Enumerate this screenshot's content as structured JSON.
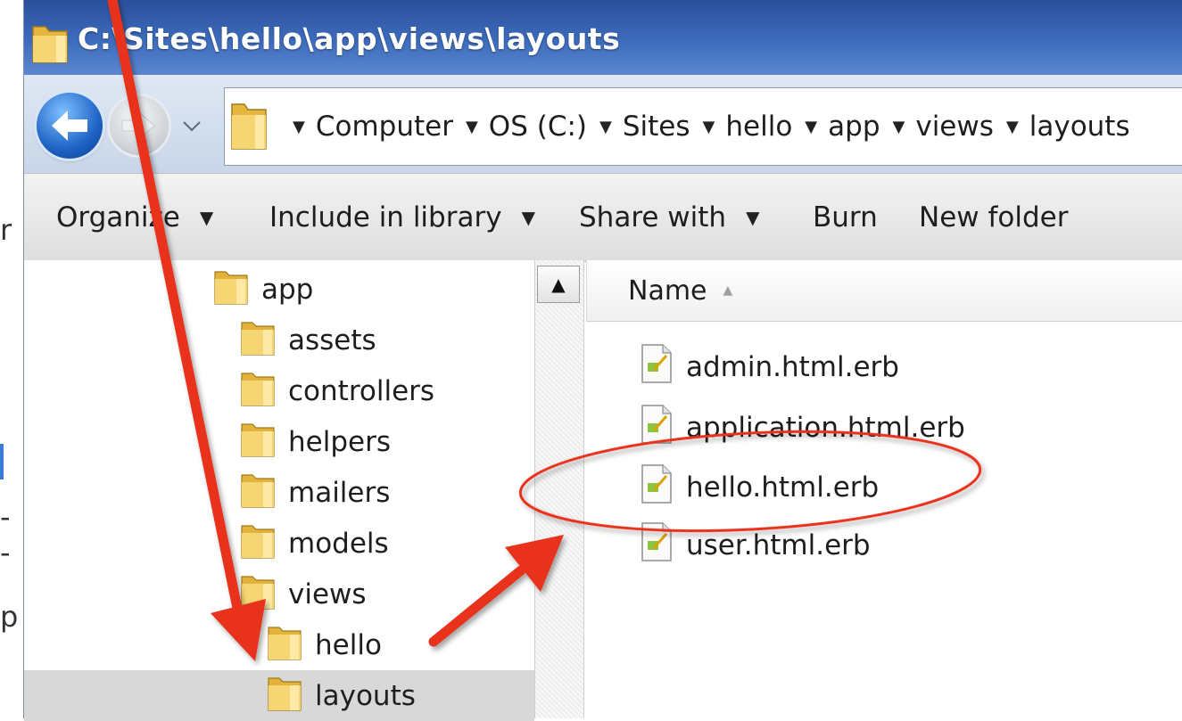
{
  "window": {
    "title": "C:\\Sites\\hello\\app\\views\\layouts"
  },
  "background_window": {
    "fragments": [
      "r",
      "-",
      "-",
      "p"
    ]
  },
  "address_bar": {
    "crumbs": [
      "Computer",
      "OS (C:)",
      "Sites",
      "hello",
      "app",
      "views",
      "layouts"
    ]
  },
  "commands": {
    "organize": "Organize",
    "include_in_library": "Include in library",
    "share_with": "Share with",
    "burn": "Burn",
    "new_folder": "New folder"
  },
  "nav_tree": {
    "items": [
      {
        "label": "app",
        "depth": 0
      },
      {
        "label": "assets",
        "depth": 1
      },
      {
        "label": "controllers",
        "depth": 1
      },
      {
        "label": "helpers",
        "depth": 1
      },
      {
        "label": "mailers",
        "depth": 1
      },
      {
        "label": "models",
        "depth": 1
      },
      {
        "label": "views",
        "depth": 1
      },
      {
        "label": "hello",
        "depth": 2
      },
      {
        "label": "layouts",
        "depth": 2,
        "selected": true
      }
    ]
  },
  "file_list": {
    "column_name": "Name",
    "files": [
      "admin.html.erb",
      "application.html.erb",
      "hello.html.erb",
      "user.html.erb"
    ],
    "highlighted_file": "hello.html.erb"
  },
  "icons": {
    "back": "back-arrow-icon",
    "forward": "forward-arrow-icon",
    "folder": "folder-icon",
    "file": "erb-file-icon"
  },
  "colors": {
    "annotation": "#e8321e",
    "titlebar": "#2f5aa8",
    "selection": "#d8d8d8"
  }
}
